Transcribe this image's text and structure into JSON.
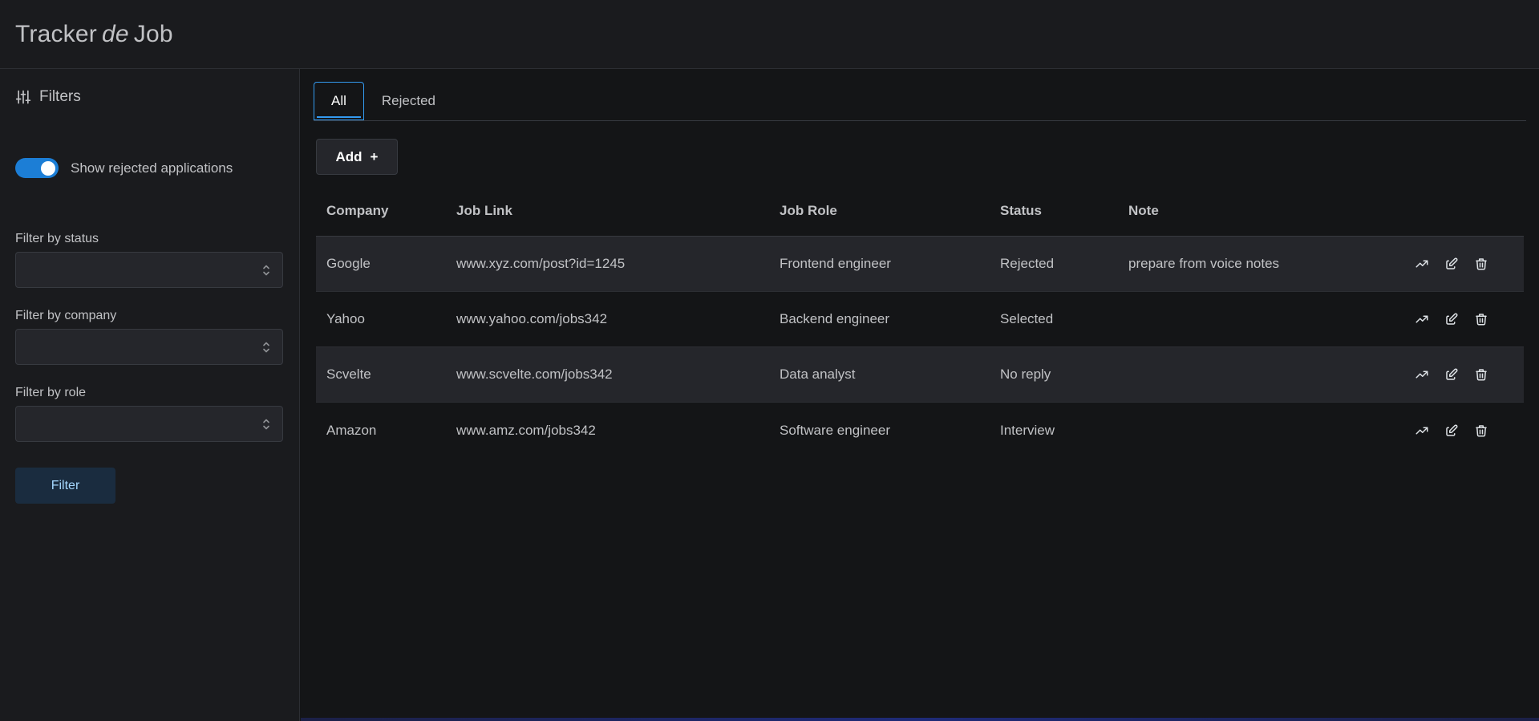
{
  "header": {
    "title_left": "Tracker",
    "title_mid": "de",
    "title_right": "Job"
  },
  "sidebar": {
    "filters_label": "Filters",
    "toggle_label": "Show rejected applications",
    "toggle_on": true,
    "status_label": "Filter by status",
    "company_label": "Filter by company",
    "role_label": "Filter by role",
    "filter_button": "Filter"
  },
  "tabs": [
    {
      "label": "All",
      "active": true
    },
    {
      "label": "Rejected",
      "active": false
    }
  ],
  "add_button": "Add",
  "add_icon": "+",
  "table": {
    "headers": [
      "Company",
      "Job Link",
      "Job Role",
      "Status",
      "Note"
    ],
    "rows": [
      {
        "company": "Google",
        "link": "www.xyz.com/post?id=1245",
        "role": "Frontend engineer",
        "status": "Rejected",
        "note": "prepare from voice notes"
      },
      {
        "company": "Yahoo",
        "link": "www.yahoo.com/jobs342",
        "role": "Backend engineer",
        "status": "Selected",
        "note": ""
      },
      {
        "company": "Scvelte",
        "link": "www.scvelte.com/jobs342",
        "role": "Data analyst",
        "status": "No reply",
        "note": ""
      },
      {
        "company": "Amazon",
        "link": "www.amz.com/jobs342",
        "role": "Software engineer",
        "status": "Interview",
        "note": ""
      }
    ]
  },
  "icons": {
    "filters": "adjustments-icon",
    "trend": "trend-icon",
    "edit": "edit-icon",
    "delete": "trash-icon",
    "chevron": "selector-icon"
  },
  "colors": {
    "accent": "#1c7ed6",
    "filter_text": "#a5d8ff"
  }
}
